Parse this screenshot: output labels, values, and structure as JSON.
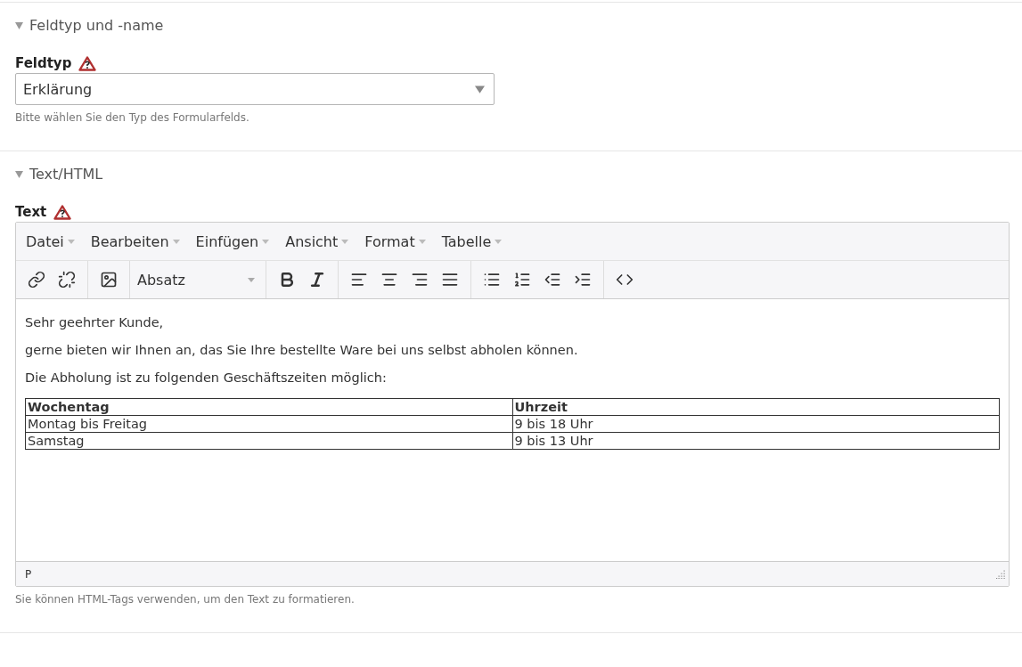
{
  "sections": [
    {
      "heading": "Feldtyp und -name",
      "expanded": true,
      "field": {
        "kind": "select",
        "label": "Feldtyp",
        "required": true,
        "value": "Erklärung",
        "help": "Bitte wählen Sie den Typ des Formularfelds."
      }
    },
    {
      "heading": "Text/HTML",
      "expanded": true,
      "field": {
        "kind": "editor",
        "label": "Text",
        "required": true,
        "help": "Sie können HTML-Tags verwenden, um den Text zu formatieren.",
        "menus": [
          "Datei",
          "Bearbeiten",
          "Einfügen",
          "Ansicht",
          "Format",
          "Tabelle"
        ],
        "toolbar": [
          [
            {
              "kind": "link"
            },
            {
              "kind": "unlink"
            }
          ],
          [
            {
              "kind": "image"
            }
          ],
          [
            {
              "kind": "block-format",
              "value": "Absatz"
            }
          ],
          [
            {
              "kind": "bold"
            },
            {
              "kind": "italic"
            }
          ],
          [
            {
              "kind": "align-left"
            },
            {
              "kind": "align-center"
            },
            {
              "kind": "align-right"
            },
            {
              "kind": "align-justify"
            }
          ],
          [
            {
              "kind": "bullet-list"
            },
            {
              "kind": "numbered-list"
            },
            {
              "kind": "outdent"
            },
            {
              "kind": "indent"
            }
          ],
          [
            {
              "kind": "source-code"
            }
          ]
        ],
        "paragraphs": [
          "Sehr geehrter Kunde,",
          "gerne bieten wir Ihnen an, das Sie Ihre bestellte Ware bei uns selbst abholen können.",
          "Die Abholung ist zu folgenden Geschäftszeiten möglich:"
        ],
        "table": {
          "columns": [
            "Wochentag",
            "Uhrzeit"
          ],
          "rows": [
            [
              "Montag bis Freitag",
              "9 bis 18 Uhr"
            ],
            [
              "Samstag",
              "9 bis 13 Uhr"
            ]
          ]
        },
        "status_path": "P"
      }
    }
  ]
}
